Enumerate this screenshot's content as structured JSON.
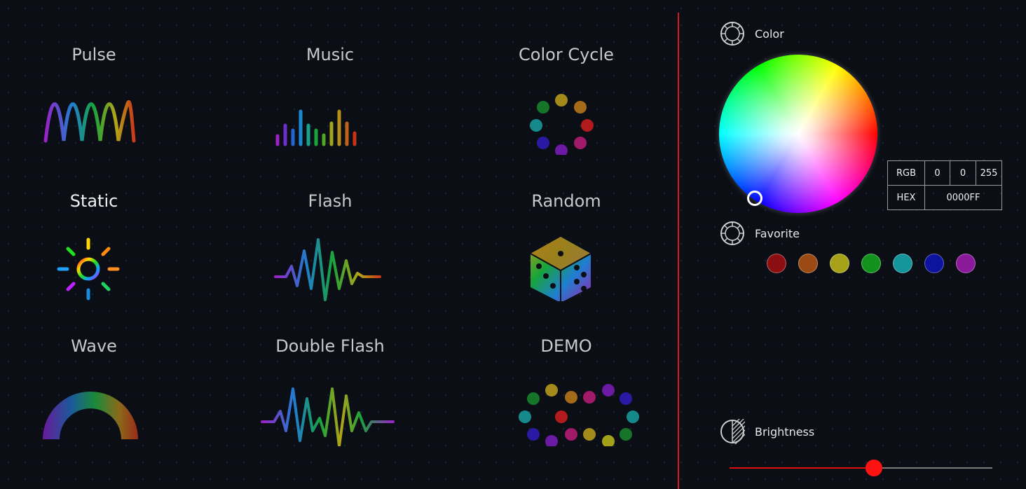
{
  "modes": [
    {
      "label": "Pulse",
      "icon": "pulse-wave-icon"
    },
    {
      "label": "Music",
      "icon": "music-bars-icon"
    },
    {
      "label": "Color Cycle",
      "icon": "color-cycle-dots-icon"
    },
    {
      "label": "Static",
      "icon": "sun-icon"
    },
    {
      "label": "Flash",
      "icon": "flash-wave-icon"
    },
    {
      "label": "Random",
      "icon": "dice-icon"
    },
    {
      "label": "Wave",
      "icon": "rainbow-arc-icon"
    },
    {
      "label": "Double Flash",
      "icon": "double-flash-wave-icon"
    },
    {
      "label": "DEMO",
      "icon": "demo-dots-icon"
    }
  ],
  "active_mode": "Static",
  "color_panel": {
    "title": "Color",
    "rgb_label": "RGB",
    "r": "0",
    "g": "0",
    "b": "255",
    "hex_label": "HEX",
    "hex": "0000FF"
  },
  "favorite": {
    "title": "Favorite",
    "colors": [
      "#8b0f12",
      "#9a4a12",
      "#a7a019",
      "#12921d",
      "#14959a",
      "#0d139c",
      "#8a1a9a"
    ]
  },
  "brightness": {
    "title": "Brightness",
    "value": 0.55
  },
  "accent_color": "#d4191c"
}
